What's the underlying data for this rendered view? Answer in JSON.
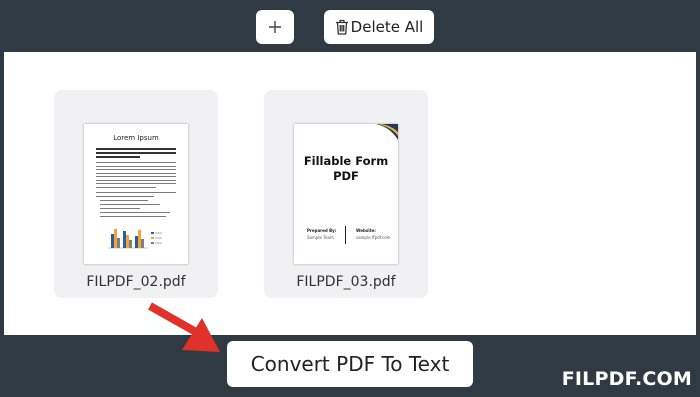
{
  "toolbar": {
    "add_icon": "plus-icon",
    "delete_icon": "trash-icon",
    "delete_label": "Delete All"
  },
  "files": [
    {
      "name": "FILPDF_02.pdf",
      "preview_title": "Lorem Ipsum",
      "chart_bar_colors": [
        "#2c5d9e",
        "#f2a33a",
        "#7f7f7f"
      ]
    },
    {
      "name": "FILPDF_03.pdf",
      "preview_title": "Fillable Form PDF",
      "prepared_by_label": "Prepared By:",
      "prepared_by_value": "Sample Team",
      "website_label": "Website:",
      "website_value": "sample.ffpdf.com",
      "accent_colors": [
        "#1f3b63",
        "#f0b323"
      ]
    }
  ],
  "actions": {
    "convert_label": "Convert PDF To Text",
    "arrow_color": "#e0322b"
  },
  "watermark": "FILPDF.COM"
}
